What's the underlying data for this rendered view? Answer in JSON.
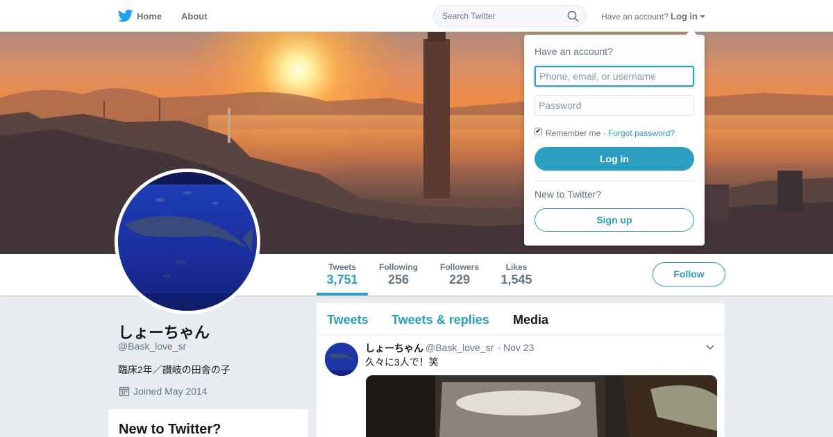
{
  "nav": {
    "home_label": "Home",
    "about_label": "About",
    "search_placeholder": "Search Twitter",
    "have_account": "Have an account?",
    "login_label": "Log in"
  },
  "profile": {
    "name": "しょーちゃん",
    "handle": "@Bask_love_sr",
    "bio": "臨床2年／讃岐の田舎の子",
    "joined": "Joined May 2014"
  },
  "stats": [
    {
      "label": "Tweets",
      "value": "3,751"
    },
    {
      "label": "Following",
      "value": "256"
    },
    {
      "label": "Followers",
      "value": "229"
    },
    {
      "label": "Likes",
      "value": "1,545"
    }
  ],
  "follow_label": "Follow",
  "timeline": {
    "tabs": [
      "Tweets",
      "Tweets & replies",
      "Media"
    ],
    "tweet": {
      "name": "しょーちゃん",
      "handle": "@Bask_love_sr",
      "separator": "·",
      "date": "Nov 23",
      "text": "久々に3人で！笑"
    }
  },
  "sidebar_card": {
    "title": "New to Twitter?"
  },
  "login_dropdown": {
    "heading": "Have an account?",
    "username_placeholder": "Phone, email, or username",
    "password_placeholder": "Password",
    "remember_label": "Remember me ·",
    "remember_checked": true,
    "forgot_label": "Forgot password?",
    "login_button": "Log in",
    "new_heading": "New to Twitter?",
    "signup_button": "Sign up"
  },
  "colors": {
    "accent": "#2b9fc0",
    "twitter_blue": "#1da1f2"
  }
}
